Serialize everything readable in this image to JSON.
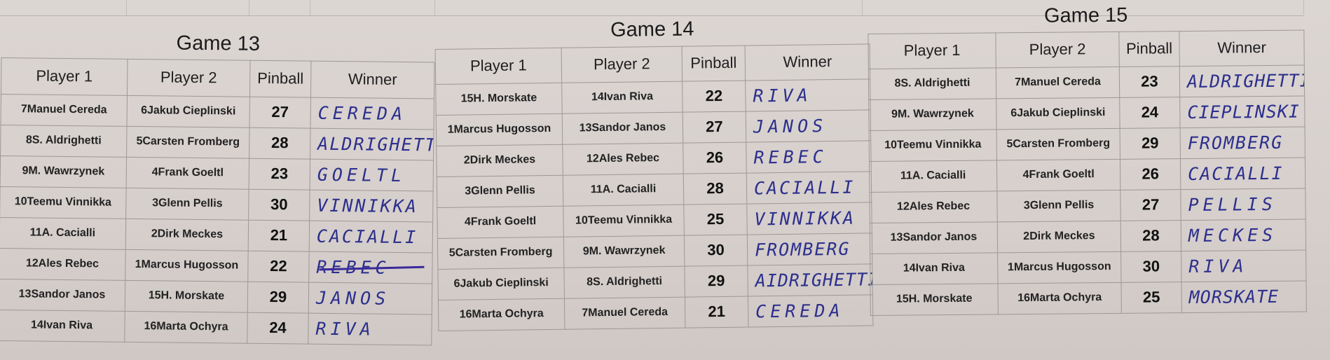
{
  "columns": {
    "player1": "Player 1",
    "player2": "Player 2",
    "pinball": "Pinball",
    "winner": "Winner"
  },
  "games": [
    {
      "title": "Game 13",
      "rows": [
        {
          "player1": "7Manuel Cereda",
          "player2": "6Jakub Cieplinski",
          "pinball": "27",
          "winner": "CEREDA"
        },
        {
          "player1": "8S. Aldrighetti",
          "player2": "5Carsten Fromberg",
          "pinball": "28",
          "winner": "ALDRIGHETTI"
        },
        {
          "player1": "9M. Wawrzynek",
          "player2": "4Frank Goeltl",
          "pinball": "23",
          "winner": "GOELTL"
        },
        {
          "player1": "10Teemu Vinnikka",
          "player2": "3Glenn Pellis",
          "pinball": "30",
          "winner": "VINNIKKA"
        },
        {
          "player1": "11A. Cacialli",
          "player2": "2Dirk Meckes",
          "pinball": "21",
          "winner": "CACIALLI"
        },
        {
          "player1": "12Ales Rebec",
          "player2": "1Marcus Hugosson",
          "pinball": "22",
          "winner": "REBEC"
        },
        {
          "player1": "13Sandor Janos",
          "player2": "15H. Morskate",
          "pinball": "29",
          "winner": "JANOS"
        },
        {
          "player1": "14Ivan Riva",
          "player2": "16Marta Ochyra",
          "pinball": "24",
          "winner": "RIVA"
        }
      ]
    },
    {
      "title": "Game 14",
      "rows": [
        {
          "player1": "15H. Morskate",
          "player2": "14Ivan Riva",
          "pinball": "22",
          "winner": "RIVA"
        },
        {
          "player1": "1Marcus Hugosson",
          "player2": "13Sandor Janos",
          "pinball": "27",
          "winner": "JANOS"
        },
        {
          "player1": "2Dirk Meckes",
          "player2": "12Ales Rebec",
          "pinball": "26",
          "winner": "REBEC"
        },
        {
          "player1": "3Glenn Pellis",
          "player2": "11A. Cacialli",
          "pinball": "28",
          "winner": "CACIALLI"
        },
        {
          "player1": "4Frank Goeltl",
          "player2": "10Teemu Vinnikka",
          "pinball": "25",
          "winner": "VINNIKKA"
        },
        {
          "player1": "5Carsten Fromberg",
          "player2": "9M. Wawrzynek",
          "pinball": "30",
          "winner": "FROMBERG"
        },
        {
          "player1": "6Jakub Cieplinski",
          "player2": "8S. Aldrighetti",
          "pinball": "29",
          "winner": "AIDRIGHETTI"
        },
        {
          "player1": "16Marta Ochyra",
          "player2": "7Manuel Cereda",
          "pinball": "21",
          "winner": "CEREDA"
        }
      ]
    },
    {
      "title": "Game 15",
      "rows": [
        {
          "player1": "8S. Aldrighetti",
          "player2": "7Manuel Cereda",
          "pinball": "23",
          "winner": "ALDRIGHETTI"
        },
        {
          "player1": "9M. Wawrzynek",
          "player2": "6Jakub Cieplinski",
          "pinball": "24",
          "winner": "CIEPLINSKI"
        },
        {
          "player1": "10Teemu Vinnikka",
          "player2": "5Carsten Fromberg",
          "pinball": "29",
          "winner": "FROMBERG"
        },
        {
          "player1": "11A. Cacialli",
          "player2": "4Frank Goeltl",
          "pinball": "26",
          "winner": "CACIALLI"
        },
        {
          "player1": "12Ales Rebec",
          "player2": "3Glenn Pellis",
          "pinball": "27",
          "winner": "PELLIS"
        },
        {
          "player1": "13Sandor Janos",
          "player2": "2Dirk Meckes",
          "pinball": "28",
          "winner": "MECKES"
        },
        {
          "player1": "14Ivan Riva",
          "player2": "1Marcus Hugosson",
          "pinball": "30",
          "winner": "RIVA"
        },
        {
          "player1": "15H. Morskate",
          "player2": "16Marta Ochyra",
          "pinball": "25",
          "winner": "MORSKATE"
        }
      ]
    }
  ]
}
